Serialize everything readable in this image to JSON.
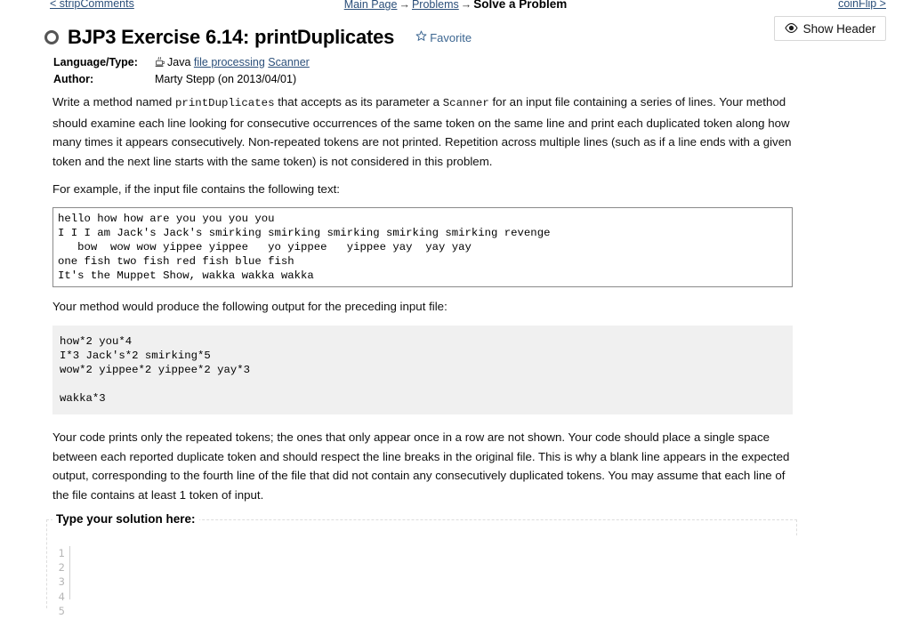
{
  "topnav": {
    "left_link": "< stripComments",
    "breadcrumb": {
      "items": [
        "Main Page",
        "Problems"
      ],
      "separator": "→",
      "current": "Solve a Problem"
    },
    "right_link": "coinFlip >"
  },
  "header_button": {
    "label": "Show Header",
    "icon": "eye-icon"
  },
  "problem": {
    "title": "BJP3 Exercise 6.14: printDuplicates",
    "favorite_label": "Favorite",
    "favorite_icon": "star-icon",
    "status_icon": "unsolved-circle-icon",
    "meta": {
      "language_label": "Language/Type:",
      "language_icon": "java-icon",
      "language_value": "Java",
      "language_tags": [
        "file processing",
        "Scanner"
      ],
      "author_label": "Author:",
      "author_value": "Marty Stepp (on 2013/04/01)"
    },
    "paragraph1_parts": {
      "a": "Write a method named ",
      "code1": "printDuplicates",
      "b": " that accepts as its parameter a ",
      "code2": "Scanner",
      "c": " for an input file containing a series of lines. Your method should examine each line looking for consecutive occurrences of the same token on the same line and print each duplicated token along how many times it appears consecutively. Non-repeated tokens are not printed. Repetition across multiple lines (such as if a line ends with a given token and the next line starts with the same token) is not considered in this problem."
    },
    "paragraph2": "For example, if the input file contains the following text:",
    "input_code": "hello how how are you you you you\nI I I am Jack's Jack's smirking smirking smirking smirking smirking revenge\n   bow  wow wow yippee yippee   yo yippee   yippee yay  yay yay\none fish two fish red fish blue fish\nIt's the Muppet Show, wakka wakka wakka",
    "paragraph3": "Your method would produce the following output for the preceding input file:",
    "output_code": "how*2 you*4\nI*3 Jack's*2 smirking*5\nwow*2 yippee*2 yippee*2 yay*3\n\nwakka*3",
    "paragraph4": "Your code prints only the repeated tokens; the ones that only appear once in a row are not shown. Your code should place a single space between each reported duplicate token and should respect the line breaks in the original file. This is why a blank line appears in the expected output, corresponding to the fourth line of the file that did not contain any consecutively duplicated tokens. You may assume that each line of the file contains at least 1 token of input."
  },
  "solution": {
    "legend": "Type your solution here:",
    "line_numbers": "1\n2\n3\n4\n5",
    "code_value": ""
  },
  "colors": {
    "link": "#2b4f7a",
    "favorite": "#3c6691",
    "output_bg": "#f0f0f0",
    "input_border": "#8b8b8b",
    "gutter_text": "#b6b6b6"
  }
}
